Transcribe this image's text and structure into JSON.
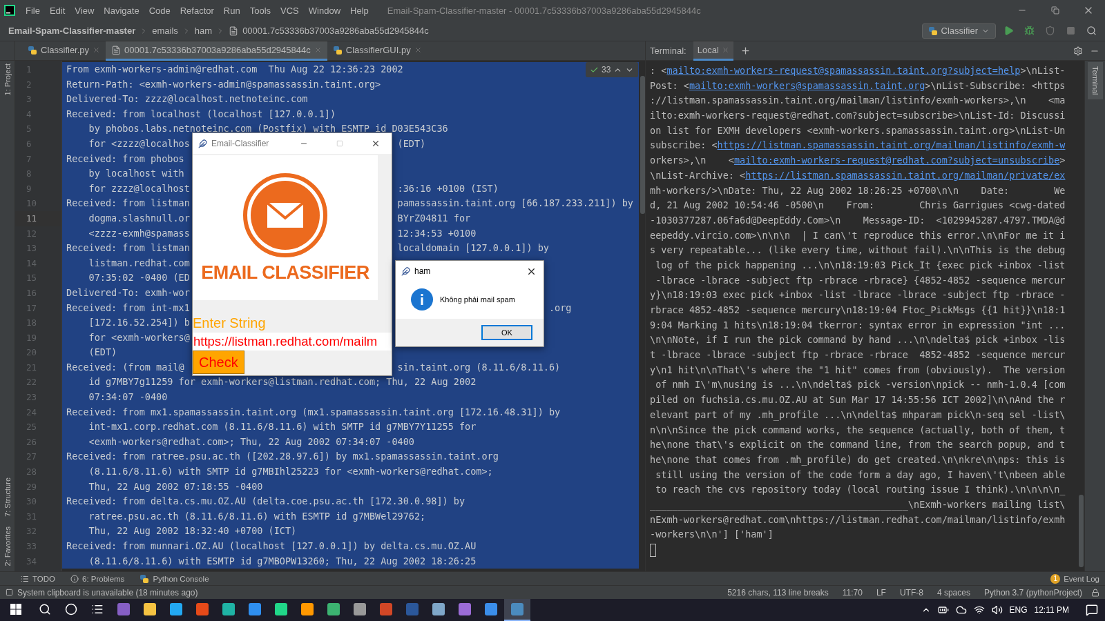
{
  "window": {
    "title": "Email-Spam-Classifier-master - 00001.7c53336b37003a9286aba55d2945844c",
    "menu": [
      "File",
      "Edit",
      "View",
      "Navigate",
      "Code",
      "Refactor",
      "Run",
      "Tools",
      "VCS",
      "Window",
      "Help"
    ]
  },
  "breadcrumbs": [
    {
      "label": "Email-Spam-Classifier-master",
      "kind": "project"
    },
    {
      "label": "emails",
      "kind": "folder"
    },
    {
      "label": "ham",
      "kind": "folder"
    },
    {
      "label": "00001.7c53336b37003a9286aba55d2945844c",
      "kind": "file"
    }
  ],
  "run_config": {
    "label": "Classifier"
  },
  "left_tools": {
    "top": [
      {
        "label": "1: Project"
      }
    ],
    "bottom": [
      {
        "label": "7: Structure"
      },
      {
        "label": "2: Favorites"
      }
    ]
  },
  "right_tools": [
    {
      "label": "Terminal"
    }
  ],
  "editor_tabs": [
    {
      "label": "Classifier.py",
      "kind": "python",
      "selected": false
    },
    {
      "label": "00001.7c53336b37003a9286aba55d2945844c",
      "kind": "text",
      "selected": true
    },
    {
      "label": "ClassifierGUI.py",
      "kind": "python",
      "selected": false
    }
  ],
  "find_widget": {
    "count": "33"
  },
  "editor": {
    "lines": [
      {
        "number": "1",
        "text": "From exmh-workers-admin@redhat.com  Thu Aug 22 12:36:23 2002",
        "selected": true,
        "current": false
      },
      {
        "number": "2",
        "text": "Return-Path: <exmh-workers-admin@spamassassin.taint.org>",
        "selected": true,
        "current": false
      },
      {
        "number": "3",
        "text": "Delivered-To: zzzz@localhost.netnoteinc.com",
        "selected": true,
        "current": false
      },
      {
        "number": "4",
        "text": "Received: from localhost (localhost [127.0.0.1])",
        "selected": true,
        "current": false
      },
      {
        "number": "5",
        "text": "    by phobos.labs.netnoteinc.com (Postfix) with ESMTP id D03E543C36",
        "selected": true,
        "current": false
      },
      {
        "number": "6",
        "text": "    for <zzzz@localhos",
        "tail": "(EDT)",
        "kind": "behind-window",
        "selected": true,
        "current": false
      },
      {
        "number": "7",
        "text": "Received: from phobos",
        "selected": true,
        "current": false
      },
      {
        "number": "8",
        "text": "    by localhost with",
        "selected": true,
        "current": false
      },
      {
        "number": "9",
        "text": "    for zzzz@localhost",
        "tail": ":36:16 +0100 (IST)",
        "kind": "behind-window",
        "selected": true,
        "current": false
      },
      {
        "number": "10",
        "text": "Received: from listman",
        "tail": "pamassassin.taint.org [66.187.233.211]) by",
        "kind": "behind-window",
        "selected": true,
        "current": false
      },
      {
        "number": "11",
        "text": "    dogma.slashnull.or",
        "tail": "BYrZ04811 for",
        "kind": "behind-window",
        "selected": true,
        "current": true
      },
      {
        "number": "12",
        "text": "    <zzzz-exmh@spamass",
        "tail": "12:34:53 +0100",
        "kind": "behind-window",
        "selected": true,
        "current": false
      },
      {
        "number": "13",
        "text": "Received: from listman",
        "tail": "localdomain [127.0.0.1]) by",
        "kind": "behind-window",
        "selected": true,
        "current": false
      },
      {
        "number": "14",
        "text": "    listman.redhat.com",
        "selected": true,
        "current": false
      },
      {
        "number": "15",
        "text": "    07:35:02 -0400 (ED",
        "selected": true,
        "current": false
      },
      {
        "number": "16",
        "text": "Delivered-To: exmh-wor",
        "selected": true,
        "current": false
      },
      {
        "number": "17",
        "text": "Received: from int-mx1",
        "tail": ".org",
        "kind": "behind-message-box",
        "selected": true,
        "current": false
      },
      {
        "number": "18",
        "text": "    [172.16.52.254]) b",
        "selected": true,
        "current": false
      },
      {
        "number": "19",
        "text": "    for <exmh-workers@",
        "selected": true,
        "current": false
      },
      {
        "number": "20",
        "text": "    (EDT)",
        "selected": true,
        "current": false
      },
      {
        "number": "21",
        "text": "Received: (from mail@",
        "tail": "sin.taint.org (8.11.6/8.11.6)",
        "kind": "behind-window",
        "selected": true,
        "current": false
      },
      {
        "number": "22",
        "text": "    id g7MBY7g11259 for exmh-workers@listman.redhat.com; Thu, 22 Aug 2002",
        "selected": true,
        "current": false
      },
      {
        "number": "23",
        "text": "    07:34:07 -0400",
        "selected": true,
        "current": false
      },
      {
        "number": "24",
        "text": "Received: from mx1.spamassassin.taint.org (mx1.spamassassin.taint.org [172.16.48.31]) by",
        "selected": true,
        "current": false
      },
      {
        "number": "25",
        "text": "    int-mx1.corp.redhat.com (8.11.6/8.11.6) with SMTP id g7MBY7Y11255 for",
        "selected": true,
        "current": false
      },
      {
        "number": "26",
        "text": "    <exmh-workers@redhat.com>; Thu, 22 Aug 2002 07:34:07 -0400",
        "selected": true,
        "current": false
      },
      {
        "number": "27",
        "text": "Received: from ratree.psu.ac.th ([202.28.97.6]) by mx1.spamassassin.taint.org",
        "selected": true,
        "current": false
      },
      {
        "number": "28",
        "text": "    (8.11.6/8.11.6) with SMTP id g7MBIhl25223 for <exmh-workers@redhat.com>;",
        "selected": true,
        "current": false
      },
      {
        "number": "29",
        "text": "    Thu, 22 Aug 2002 07:18:55 -0400",
        "selected": true,
        "current": false
      },
      {
        "number": "30",
        "text": "Received: from delta.cs.mu.OZ.AU (delta.coe.psu.ac.th [172.30.0.98]) by",
        "selected": true,
        "current": false
      },
      {
        "number": "31",
        "text": "    ratree.psu.ac.th (8.11.6/8.11.6) with ESMTP id g7MBWel29762;",
        "selected": true,
        "current": false
      },
      {
        "number": "32",
        "text": "    Thu, 22 Aug 2002 18:32:40 +0700 (ICT)",
        "selected": true,
        "current": false
      },
      {
        "number": "33",
        "text": "Received: from munnari.OZ.AU (localhost [127.0.0.1]) by delta.cs.mu.OZ.AU",
        "selected": true,
        "current": false
      },
      {
        "number": "34",
        "text": "    (8.11.6/8.11.6) with ESMTP id g7MBOPW13260; Thu, 22 Aug 2002 18:26:25",
        "selected": true,
        "current": false
      }
    ]
  },
  "terminal": {
    "label": "Terminal:",
    "tabs": [
      {
        "label": "Local",
        "selected": true
      }
    ],
    "lines": [
      [
        {
          "text": ": <"
        },
        {
          "text": "mailto:exmh-workers-request@spamassassin.taint.org?subject=help",
          "link": true
        },
        {
          "text": ">\\nList-"
        }
      ],
      [
        {
          "text": "Post: <"
        },
        {
          "text": "mailto:exmh-workers@spamassassin.taint.org",
          "link": true
        },
        {
          "text": ">\\nList-Subscribe: <https"
        }
      ],
      [
        {
          "text": "://listman.spamassassin.taint.org/mailman/listinfo/exmh-workers>,\\n    <ma"
        }
      ],
      [
        {
          "text": "ilto:exmh-workers-request@redhat.com?subject=subscribe>\\nList-Id: Discussi"
        }
      ],
      [
        {
          "text": "on list for EXMH developers <exmh-workers.spamassassin.taint.org>\\nList-Un"
        }
      ],
      [
        {
          "text": "subscribe: <"
        },
        {
          "text": "https://listman.spamassassin.taint.org/mailman/listinfo/exmh-w",
          "link": true
        }
      ],
      [
        {
          "text": "orkers>,\\n    <"
        },
        {
          "text": "mailto:exmh-workers-request@redhat.com?subject=unsubscribe",
          "link": true
        },
        {
          "text": ">"
        }
      ],
      [
        {
          "text": "\\nList-Archive: <"
        },
        {
          "text": "https://listman.spamassassin.taint.org/mailman/private/ex",
          "link": true
        }
      ],
      [
        {
          "text": "mh-workers/>\\nDate: Thu, 22 Aug 2002 18:26:25 +0700\\n\\n    Date:        We"
        }
      ],
      [
        {
          "text": "d, 21 Aug 2002 10:54:46 -0500\\n    From:        Chris Garrigues <cwg-dated"
        }
      ],
      [
        {
          "text": "-1030377287.06fa6d@DeepEddy.Com>\\n    Message-ID:  <1029945287.4797.TMDA@d"
        }
      ],
      [
        {
          "text": "eepeddy.vircio.com>\\n\\n\\n  | I can\\'t reproduce this error.\\n\\nFor me it i"
        }
      ],
      [
        {
          "text": "s very repeatable... (like every time, without fail).\\n\\nThis is the debug"
        }
      ],
      [
        {
          "text": " log of the pick happening ...\\n\\n18:19:03 Pick_It {exec pick +inbox -list"
        }
      ],
      [
        {
          "text": " -lbrace -lbrace -subject ftp -rbrace -rbrace} {4852-4852 -sequence mercur"
        }
      ],
      [
        {
          "text": "y}\\n18:19:03 exec pick +inbox -list -lbrace -lbrace -subject ftp -rbrace -"
        }
      ],
      [
        {
          "text": "rbrace 4852-4852 -sequence mercury\\n18:19:04 Ftoc_PickMsgs {{1 hit}}\\n18:1"
        }
      ],
      [
        {
          "text": "9:04 Marking 1 hits\\n18:19:04 tkerror: syntax error in expression \"int ..."
        }
      ],
      [
        {
          "text": "\\n\\nNote, if I run the pick command by hand ...\\n\\ndelta$ pick +inbox -lis"
        }
      ],
      [
        {
          "text": "t -lbrace -lbrace -subject ftp -rbrace -rbrace  4852-4852 -sequence mercur"
        }
      ],
      [
        {
          "text": "y\\n1 hit\\n\\nThat\\'s where the \"1 hit\" comes from (obviously).  The version"
        }
      ],
      [
        {
          "text": " of nmh I\\'m\\nusing is ...\\n\\ndelta$ pick -version\\npick -- nmh-1.0.4 [com"
        }
      ],
      [
        {
          "text": "piled on fuchsia.cs.mu.OZ.AU at Sun Mar 17 14:55:56 ICT 2002]\\n\\nAnd the r"
        }
      ],
      [
        {
          "text": "elevant part of my .mh_profile ...\\n\\ndelta$ mhparam pick\\n-seq sel -list\\"
        }
      ],
      [
        {
          "text": "n\\n\\nSince the pick command works, the sequence (actually, both of them, t"
        }
      ],
      [
        {
          "text": "he\\none that\\'s explicit on the command line, from the search popup, and t"
        }
      ],
      [
        {
          "text": "he\\none that comes from .mh_profile) do get created.\\n\\nkre\\n\\nps: this is"
        }
      ],
      [
        {
          "text": " still using the version of the code form a day ago, I haven\\'t\\nbeen able"
        }
      ],
      [
        {
          "text": " to reach the cvs repository today (local routing issue I think).\\n\\n\\n\\n_"
        }
      ],
      [
        {
          "text": "______________________________________________\\nExmh-workers mailing list\\"
        }
      ],
      [
        {
          "text": "nExmh-workers@redhat.com\\nhttps://listman.redhat.com/mailman/listinfo/exmh"
        }
      ],
      [
        {
          "text": "-workers\\n\\n'] ['ham']"
        }
      ]
    ]
  },
  "classifier_window": {
    "title": "Email-Classifier",
    "logo_text": "EMAIL CLASSIFIER",
    "prompt": "Enter String",
    "value": "https://listman.redhat.com/mailm",
    "button": "Check"
  },
  "message_box": {
    "title": "ham",
    "message": "Không phải mail spam",
    "button": "OK"
  },
  "tool_buttons": [
    {
      "label": "TODO",
      "kind": "list"
    },
    {
      "label": "6: Problems",
      "kind": "info"
    },
    {
      "label": "Python Console",
      "kind": "python"
    }
  ],
  "event_log": {
    "label": "Event Log",
    "count": "1"
  },
  "status_bar": {
    "message": "System clipboard is unavailable (18 minutes ago)",
    "items": [
      "5216 chars, 113 line breaks",
      "11:70",
      "LF",
      "UTF-8",
      "4 spaces",
      "Python 3.7 (pythonProject)"
    ]
  },
  "taskbar": {
    "apps": [
      {
        "kind": "visual-studio",
        "selected": false
      },
      {
        "kind": "explorer",
        "selected": false
      },
      {
        "kind": "vscode",
        "selected": false
      },
      {
        "kind": "office",
        "selected": false
      },
      {
        "kind": "edge",
        "selected": false
      },
      {
        "kind": "document",
        "selected": false
      },
      {
        "kind": "pycharm",
        "selected": false
      },
      {
        "kind": "sublime",
        "selected": false
      },
      {
        "kind": "notebook",
        "selected": false
      },
      {
        "kind": "snipping",
        "selected": false
      },
      {
        "kind": "powerpoint",
        "selected": false
      },
      {
        "kind": "word",
        "selected": false
      },
      {
        "kind": "globe",
        "selected": false
      },
      {
        "kind": "visual-studio-outline",
        "selected": false
      },
      {
        "kind": "mail",
        "selected": false
      },
      {
        "kind": "python",
        "selected": true
      }
    ],
    "language": "ENG",
    "time": "12:11 PM"
  }
}
